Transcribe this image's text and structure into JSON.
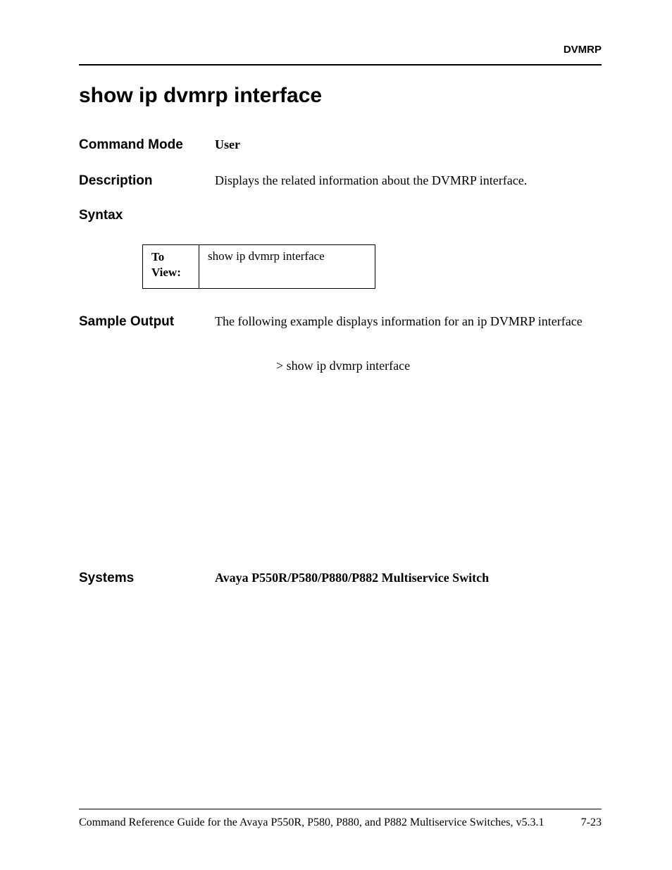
{
  "header": {
    "section": "DVMRP"
  },
  "title": "show ip dvmrp interface",
  "command_mode": {
    "label": "Command Mode",
    "value": "User"
  },
  "description": {
    "label": "Description",
    "value": "Displays the related information about the DVMRP interface."
  },
  "syntax": {
    "label": "Syntax",
    "table": {
      "left": "To View:",
      "right": "show ip dvmrp interface"
    }
  },
  "sample_output": {
    "label": "Sample Output",
    "text": "The following example displays information for an ip DVMRP interface",
    "command": "> show ip dvmrp interface"
  },
  "systems": {
    "label": "Systems",
    "value": "Avaya P550R/P580/P880/P882 Multiservice Switch"
  },
  "footer": {
    "guide": "Command Reference Guide for the Avaya P550R, P580, P880, and P882 Multiservice Switches, v5.3.1",
    "page": "7-23"
  }
}
